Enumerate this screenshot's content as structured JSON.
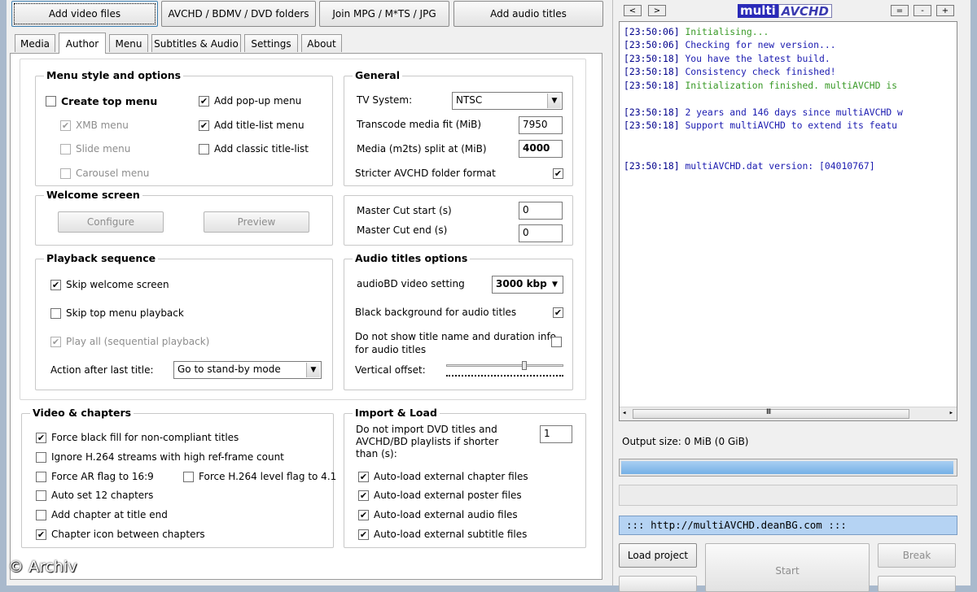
{
  "top_buttons": [
    "Add video files",
    "AVCHD / BDMV / DVD folders",
    "Join MPG / M*TS / JPG",
    "Add audio titles"
  ],
  "tabs": [
    "Media",
    "Author",
    "Menu",
    "Subtitles & Audio",
    "Settings",
    "About"
  ],
  "active_tab": "Author",
  "menu_style": {
    "title": "Menu style and options",
    "create_top_menu": "Create top menu",
    "xmb_menu": "XMB menu",
    "slide_menu": "Slide menu",
    "carousel_menu": "Carousel menu",
    "add_popup_menu": "Add pop-up menu",
    "add_title_list_menu": "Add title-list menu",
    "add_classic_title_list": "Add classic title-list"
  },
  "welcome": {
    "title": "Welcome screen",
    "configure": "Configure",
    "preview": "Preview"
  },
  "playback": {
    "title": "Playback sequence",
    "skip_welcome": "Skip welcome screen",
    "skip_top_menu": "Skip top menu playback",
    "play_all": "Play all (sequential playback)",
    "action_label": "Action after last title:",
    "action_value": "Go to stand-by mode"
  },
  "general": {
    "title": "General",
    "tv_system_label": "TV System:",
    "tv_system_value": "NTSC",
    "transcode_label": "Transcode media fit (MiB)",
    "transcode_value": "7950",
    "split_label": "Media (m2ts) split at (MiB)",
    "split_value": "4000",
    "stricter_label": "Stricter AVCHD folder format"
  },
  "master_cut": {
    "start_label": "Master Cut start (s)",
    "start_value": "0",
    "end_label": "Master Cut end (s)",
    "end_value": "0"
  },
  "audio_titles": {
    "title": "Audio titles options",
    "audiobd_label": "audioBD video setting",
    "audiobd_value": "3000 kbp",
    "black_bg": "Black background for audio titles",
    "no_title_line1": "Do not show title name and duration info",
    "no_title_line2": "for audio titles",
    "vertical_offset": "Vertical offset:",
    "vertical_offset_level": 0.68
  },
  "video_chapters": {
    "title": "Video & chapters",
    "force_black": "Force black fill for non-compliant titles",
    "ignore_h264": "Ignore H.264 streams with high ref-frame count",
    "force_ar": "Force AR flag to 16:9",
    "force_level": "Force H.264 level flag to 4.1",
    "auto_chapters": "Auto set 12 chapters",
    "chapter_at_end": "Add chapter at title end",
    "chapter_icon": "Chapter icon between chapters"
  },
  "import_load": {
    "title": "Import & Load",
    "dont_import_line1": "Do not import DVD titles and",
    "dont_import_line2": "AVCHD/BD playlists if shorter",
    "dont_import_line3": "than (s):",
    "dont_import_value": "1",
    "auto_chapter": "Auto-load external chapter files",
    "auto_poster": "Auto-load external poster files",
    "auto_audio": "Auto-load external audio files",
    "auto_subtitle": "Auto-load external subtitle files"
  },
  "right": {
    "nav_buttons": [
      "<",
      ">"
    ],
    "logo_a": "multi",
    "logo_b": "AVCHD",
    "win_buttons": [
      "=",
      "-",
      "+"
    ],
    "log": [
      {
        "ts": "[23:50:06]",
        "msg": "Initialising...",
        "color": "#3a9a28"
      },
      {
        "ts": "[23:50:06]",
        "msg": "Checking for new version...",
        "color": "#1b1bb0"
      },
      {
        "ts": "[23:50:18]",
        "msg": "You have the latest build.",
        "color": "#1b1bb0"
      },
      {
        "ts": "[23:50:18]",
        "msg": "Consistency check finished!",
        "color": "#1b1bb0"
      },
      {
        "ts": "[23:50:18]",
        "msg": "Initialization finished. multiAVCHD is",
        "color": "#3a9a28"
      },
      {
        "ts": "[23:50:18]",
        "msg": "2 years and 146 days since multiAVCHD w",
        "color": "#1b1bb0"
      },
      {
        "ts": "[23:50:18]",
        "msg": "Support multiAVCHD to extend its featu",
        "color": "#1b1bb0"
      },
      {
        "ts": "[23:50:18]",
        "msg": "multiAVCHD.dat version: [04010767]",
        "color": "#1b1bb0"
      }
    ],
    "output_size": "Output size: 0 MiB (0 GiB)",
    "url": "::: http://multiAVCHD.deanBG.com :::",
    "load_project": "Load project",
    "start": "Start",
    "break": "Break",
    "progress_fraction": 1.0
  },
  "watermark": "© Archiv"
}
